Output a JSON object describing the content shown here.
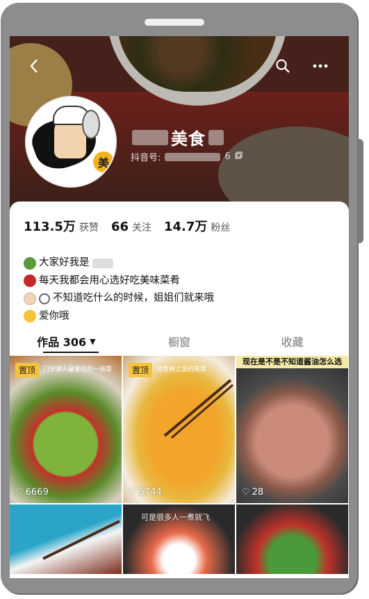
{
  "header": {
    "back_icon": "chevron-left-icon",
    "search_icon": "search-icon",
    "more_icon": "more-dots-icon",
    "name": "美食",
    "douyin_id_label": "抖音号:",
    "douyin_id_tail": "6",
    "avatar_badge": "美"
  },
  "stats": [
    {
      "value": "113.5万",
      "label": "获赞"
    },
    {
      "value": "66",
      "label": "关注"
    },
    {
      "value": "14.7万",
      "label": "粉丝"
    }
  ],
  "bio": {
    "line1": "大家好我是",
    "line2": "每天我都会用心选好吃美味菜肴",
    "line3": "不知道吃什么的时候，姐姐们就来哦",
    "line4": "爱你哦"
  },
  "tabs": {
    "works": "作品 306",
    "window": "橱窗",
    "favorites": "收藏"
  },
  "videos": [
    {
      "pin": "置顶",
      "caption": "门宁波人最爱吃的一道菜",
      "likes": "6669"
    },
    {
      "pin": "置顶",
      "caption": "清香鲜上饭的蒸菜",
      "likes": "5744"
    },
    {
      "caption": "现在是不是不知道酱油怎么选",
      "likes": "28"
    },
    {
      "caption": ""
    },
    {
      "caption": "可是很多人一煮就飞"
    },
    {
      "caption": ""
    }
  ]
}
